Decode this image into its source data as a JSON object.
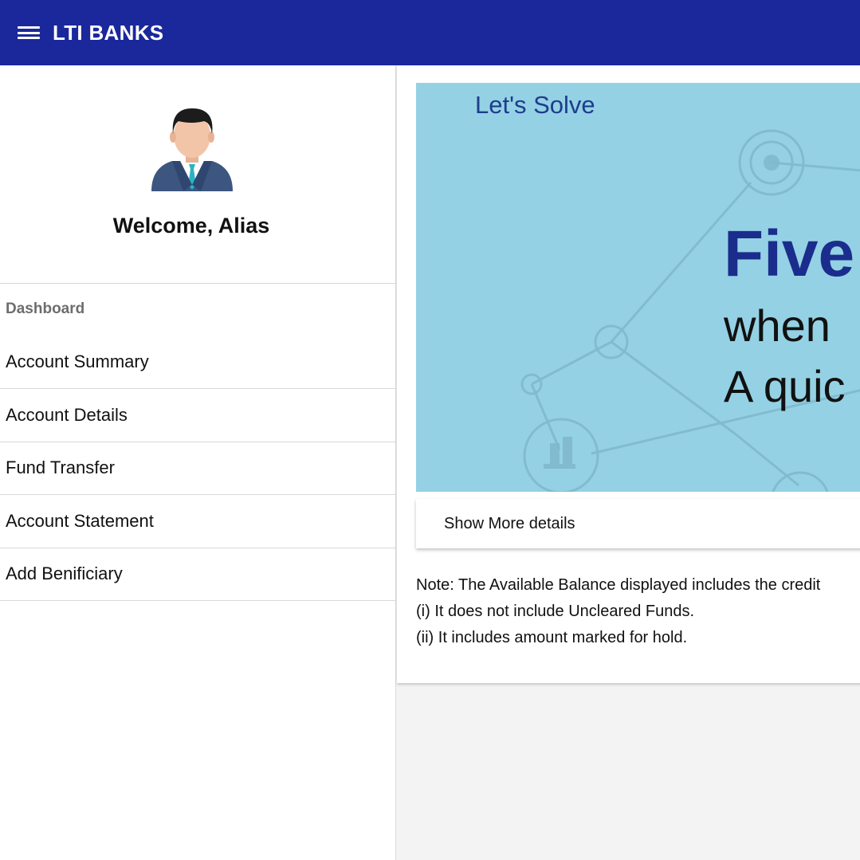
{
  "appbar": {
    "title": "LTI BANKS"
  },
  "sidebar": {
    "welcome": "Welcome, Alias",
    "section_header": "Dashboard",
    "items": [
      {
        "label": "Account Summary"
      },
      {
        "label": "Account Details"
      },
      {
        "label": "Fund Transfer"
      },
      {
        "label": "Account Statement"
      },
      {
        "label": "Add Benificiary"
      }
    ]
  },
  "banner": {
    "kicker": "Let's Solve",
    "headline": "Five",
    "line1": "when",
    "line2": "A quic"
  },
  "more_details": {
    "label": "Show More details"
  },
  "notes": {
    "line1": "Note: The Available Balance displayed includes the credit",
    "line2": "(i) It does not include Uncleared Funds.",
    "line3": "(ii) It includes amount marked for hold."
  },
  "colors": {
    "appbar": "#1a289b",
    "banner_bg": "#94d1e4",
    "headline": "#1a2d8c"
  },
  "icons": [
    "menu-icon",
    "user-avatar-icon"
  ]
}
